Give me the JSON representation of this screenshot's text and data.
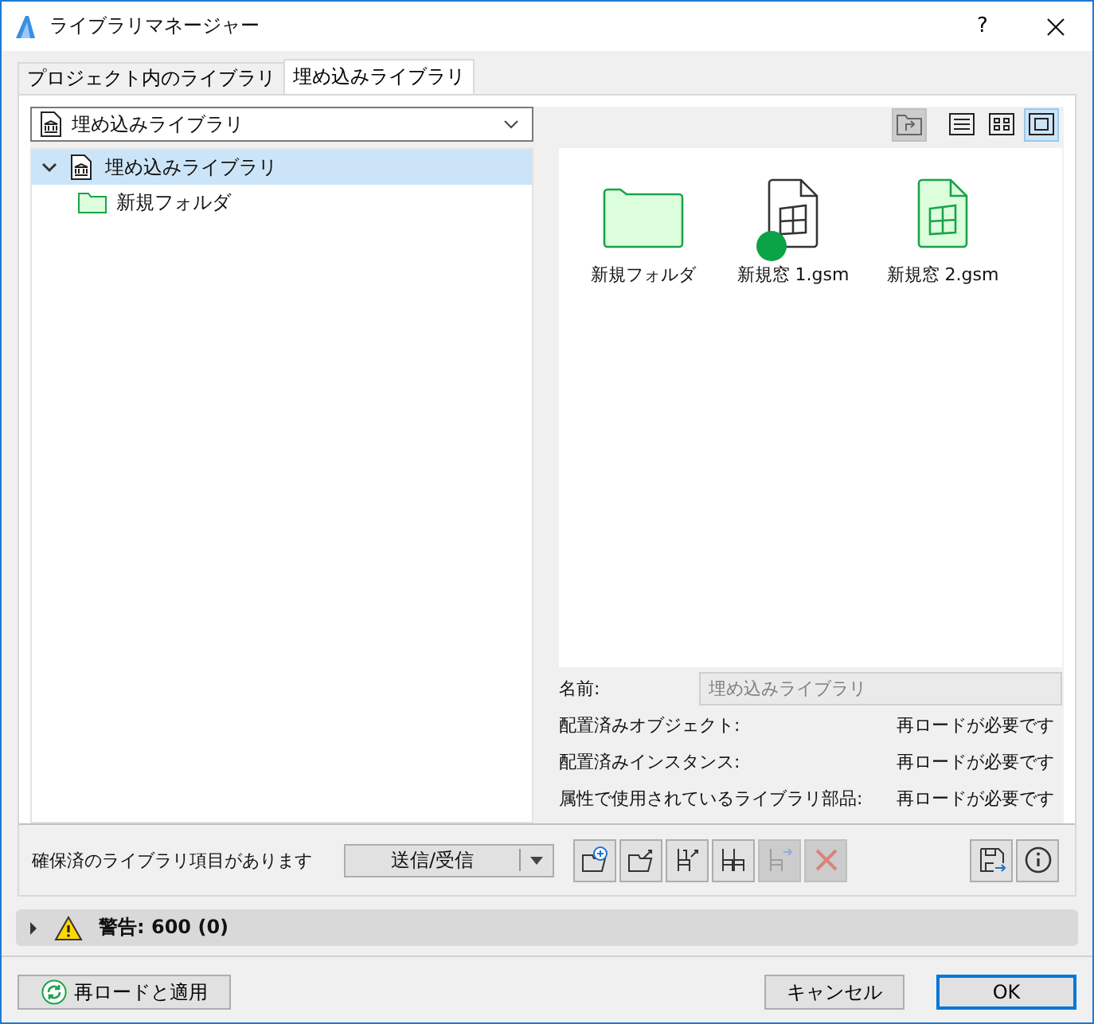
{
  "window": {
    "title": "ライブラリマネージャー",
    "help": "?"
  },
  "tabs": [
    {
      "label": "プロジェクト内のライブラリ",
      "selected": false
    },
    {
      "label": "埋め込みライブラリ",
      "selected": true
    }
  ],
  "library_dropdown": {
    "value": "埋め込みライブラリ"
  },
  "tree": [
    {
      "label": "埋め込みライブラリ",
      "kind": "library",
      "expanded": true,
      "selected": true,
      "children": [
        {
          "label": "新規フォルダ",
          "kind": "folder",
          "selected": false
        }
      ]
    }
  ],
  "view_buttons": [
    {
      "kind": "up",
      "disabled": true,
      "selected": false
    },
    {
      "kind": "list",
      "disabled": false,
      "selected": false
    },
    {
      "kind": "grid",
      "disabled": false,
      "selected": false
    },
    {
      "kind": "large",
      "disabled": false,
      "selected": true
    }
  ],
  "items": [
    {
      "label": "新規フォルダ",
      "kind": "folder",
      "embedded": true,
      "placed": false
    },
    {
      "label": "新規窓 1.gsm",
      "kind": "file",
      "embedded": false,
      "placed": true
    },
    {
      "label": "新規窓 2.gsm",
      "kind": "file",
      "embedded": true,
      "placed": false
    }
  ],
  "details": {
    "name_label": "名前:",
    "name_value": "埋め込みライブラリ",
    "rows": [
      {
        "label": "配置済みオブジェクト:",
        "value": "再ロードが必要です"
      },
      {
        "label": "配置済みインスタンス:",
        "value": "再ロードが必要です"
      },
      {
        "label": "属性で使用されているライブラリ部品:",
        "value": "再ロードが必要です"
      }
    ]
  },
  "status": "確保済のライブラリ項目があります",
  "send_button": {
    "label": "送信/受信"
  },
  "tools": [
    {
      "kind": "add-folder",
      "disabled": false
    },
    {
      "kind": "export-folder",
      "disabled": false
    },
    {
      "kind": "export-object",
      "disabled": false
    },
    {
      "kind": "objects",
      "disabled": false
    },
    {
      "kind": "move-object",
      "disabled": true
    },
    {
      "kind": "delete",
      "disabled": true
    }
  ],
  "side_tools": [
    {
      "kind": "save",
      "disabled": false
    },
    {
      "kind": "info",
      "disabled": false
    }
  ],
  "warning": {
    "label": "警告: 600 (0)",
    "expanded": false
  },
  "buttons": [
    {
      "kind": "reload",
      "label": "再ロードと適用",
      "default": false
    },
    {
      "kind": "cancel",
      "label": "キャンセル",
      "default": false
    },
    {
      "kind": "ok",
      "label": "OK",
      "default": true
    }
  ]
}
